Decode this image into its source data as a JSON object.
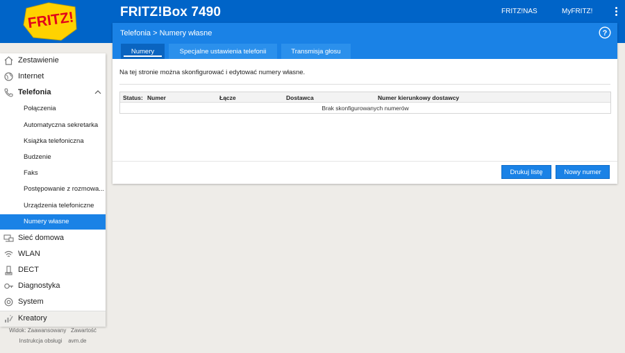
{
  "header": {
    "logo_text": "FRITZ!",
    "product": "FRITZ!Box 7490",
    "links": [
      "FRITZ!NAS",
      "MyFRITZ!"
    ]
  },
  "sidebar": {
    "items": [
      {
        "label": "Zestawienie",
        "icon": "home-icon"
      },
      {
        "label": "Internet",
        "icon": "globe-icon"
      },
      {
        "label": "Telefonia",
        "icon": "phone-icon"
      },
      {
        "label": "Połączenia"
      },
      {
        "label": "Automatyczna sekretarka"
      },
      {
        "label": "Książka telefoniczna"
      },
      {
        "label": "Budzenie"
      },
      {
        "label": "Faks"
      },
      {
        "label": "Postępowanie z rozmowa..."
      },
      {
        "label": "Urządzenia telefoniczne"
      },
      {
        "label": "Numery własne"
      },
      {
        "label": "Sieć domowa",
        "icon": "network-icon"
      },
      {
        "label": "WLAN",
        "icon": "wifi-icon"
      },
      {
        "label": "DECT",
        "icon": "dect-icon"
      },
      {
        "label": "Diagnostyka",
        "icon": "diagnostics-icon"
      },
      {
        "label": "System",
        "icon": "system-icon"
      },
      {
        "label": "Kreatory",
        "icon": "wizard-icon"
      }
    ]
  },
  "footer": {
    "line1": [
      "Widok: Zaawansowany",
      "Zawartość"
    ],
    "line2": [
      "Instrukcja obsługi",
      "avm.de"
    ]
  },
  "panel": {
    "breadcrumb": "Telefonia > Numery własne",
    "tabs": [
      "Numery",
      "Specjalne ustawienia telefonii",
      "Transmisja głosu"
    ],
    "intro": "Na tej stronie można skonfigurować i edytować numery własne.",
    "table": {
      "columns": [
        "Status:",
        "Numer",
        "Łącze",
        "Dostawca",
        "Numer kierunkowy dostawcy"
      ],
      "empty": "Brak skonfigurowanych numerów"
    },
    "buttons": {
      "print": "Drukuj listę",
      "new": "Nowy numer"
    }
  },
  "colors": {
    "brand": "#0064c8",
    "accent": "#1a82e6",
    "logo_red": "#e2001a",
    "logo_yellow": "#ffd200"
  }
}
